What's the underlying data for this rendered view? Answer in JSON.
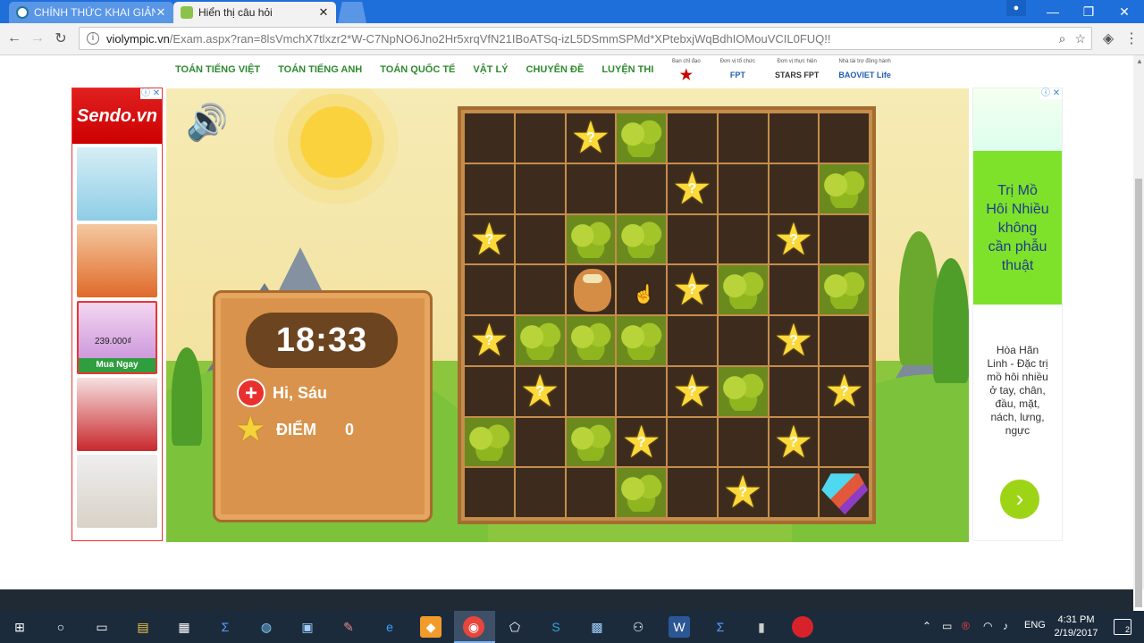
{
  "browser": {
    "tabs": [
      {
        "label": "CHÍNH THỨC KHAI GIẢNG",
        "icon": "wordpress-icon"
      },
      {
        "label": "Hiển thị câu hỏi",
        "icon": "leaf-icon"
      }
    ],
    "close_glyph": "✕",
    "url_host": "violympic.vn",
    "url_path": "/Exam.aspx?ran=8lsVmchX7tlxzr2*W-C7NpNO6Jno2Hr5xrqVfN21IBoATSq-izL5DSmmSPMd*XPtebxjWqBdhIOMouVCIL0FUQ!!"
  },
  "nav": {
    "items": [
      "TOÁN TIẾNG VIỆT",
      "TOÁN TIẾNG ANH",
      "TOÁN QUỐC TẾ",
      "VẬT LÝ",
      "CHUYÊN ĐỀ",
      "LUYỆN THI"
    ]
  },
  "sponsors": [
    {
      "caption": "Ban chỉ đạo",
      "logo": "★"
    },
    {
      "caption": "Đơn vị tổ chức",
      "logo": "FPT"
    },
    {
      "caption": "Đơn vị thực hiện",
      "logo": "STARS  FPT"
    },
    {
      "caption": "Nhà tài trợ đồng hành",
      "logo": "BAOVIET Life"
    }
  ],
  "ads": {
    "left": {
      "brand": "Sendo.vn",
      "price": "239.000₫",
      "buy": "Mua Ngay"
    },
    "right": {
      "headline": [
        "Trị Mồ",
        "Hôi Nhiều",
        "không",
        "cần phẫu",
        "thuật"
      ],
      "desc": [
        "Hòa Hãn",
        "Linh - Đặc trị",
        "mồ hôi nhiều",
        "ở tay, chân,",
        "đầu, mặt,",
        "nách, lưng,",
        "ngực"
      ],
      "next": "›"
    },
    "close_glyph": "✕"
  },
  "game": {
    "timer": "18:33",
    "player": "Hi, Sáu",
    "score_label": "ĐIỂM",
    "score": "0",
    "grid_rows": [
      [
        "e",
        "e",
        "s",
        "b",
        "e",
        "e",
        "e",
        "e"
      ],
      [
        "e",
        "e",
        "e",
        "e",
        "s",
        "e",
        "e",
        "b"
      ],
      [
        "s",
        "e",
        "b",
        "b",
        "e",
        "e",
        "s",
        "e"
      ],
      [
        "e",
        "e",
        "q",
        "e",
        "s",
        "b",
        "e",
        "b"
      ],
      [
        "s",
        "b",
        "b",
        "b",
        "e",
        "e",
        "s",
        "e"
      ],
      [
        "e",
        "s",
        "e",
        "e",
        "s",
        "b",
        "e",
        "s"
      ],
      [
        "b",
        "e",
        "b",
        "s",
        "e",
        "e",
        "s",
        "e"
      ],
      [
        "e",
        "e",
        "e",
        "b",
        "e",
        "s",
        "e",
        "g"
      ]
    ],
    "star_mark": "?"
  },
  "taskbar": {
    "lang": "ENG",
    "time": "4:31 PM",
    "date": "2/19/2017",
    "notifications": "2"
  }
}
